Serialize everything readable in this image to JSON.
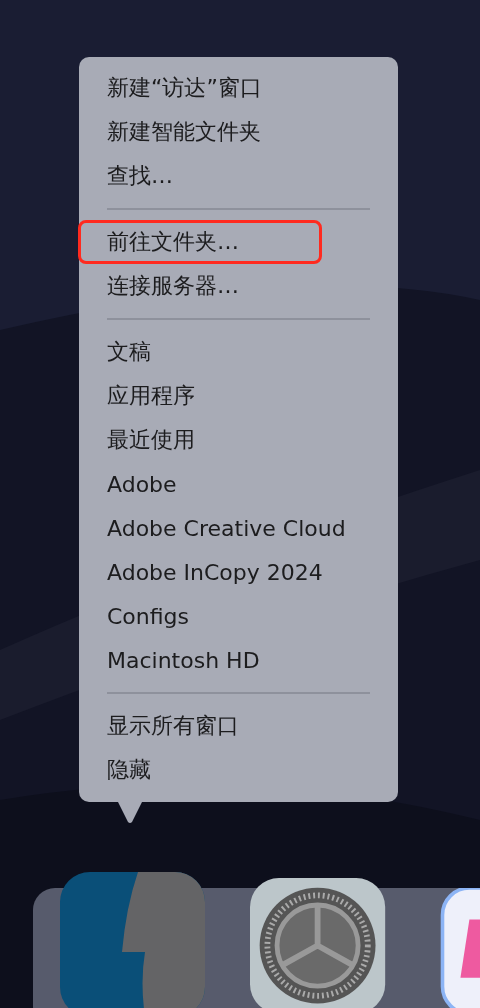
{
  "menu": {
    "sections": [
      {
        "items": [
          {
            "label": "新建“访达”窗口",
            "highlighted": false
          },
          {
            "label": "新建智能文件夹",
            "highlighted": false
          },
          {
            "label": "查找…",
            "highlighted": false
          }
        ]
      },
      {
        "items": [
          {
            "label": "前往文件夹…",
            "highlighted": true
          },
          {
            "label": "连接服务器…",
            "highlighted": false
          }
        ]
      },
      {
        "items": [
          {
            "label": "文稿",
            "highlighted": false
          },
          {
            "label": "应用程序",
            "highlighted": false
          },
          {
            "label": "最近使用",
            "highlighted": false
          },
          {
            "label": "Adobe",
            "highlighted": false
          },
          {
            "label": "Adobe Creative Cloud",
            "highlighted": false
          },
          {
            "label": "Adobe InCopy 2024",
            "highlighted": false
          },
          {
            "label": "Configs",
            "highlighted": false
          },
          {
            "label": "Macintosh HD",
            "highlighted": false
          }
        ]
      },
      {
        "items": [
          {
            "label": "显示所有窗口",
            "highlighted": false
          },
          {
            "label": "隐藏",
            "highlighted": false
          }
        ]
      }
    ]
  },
  "dock": {
    "apps": [
      {
        "kind": "finder"
      },
      {
        "kind": "settings"
      },
      {
        "kind": "partial"
      }
    ]
  }
}
